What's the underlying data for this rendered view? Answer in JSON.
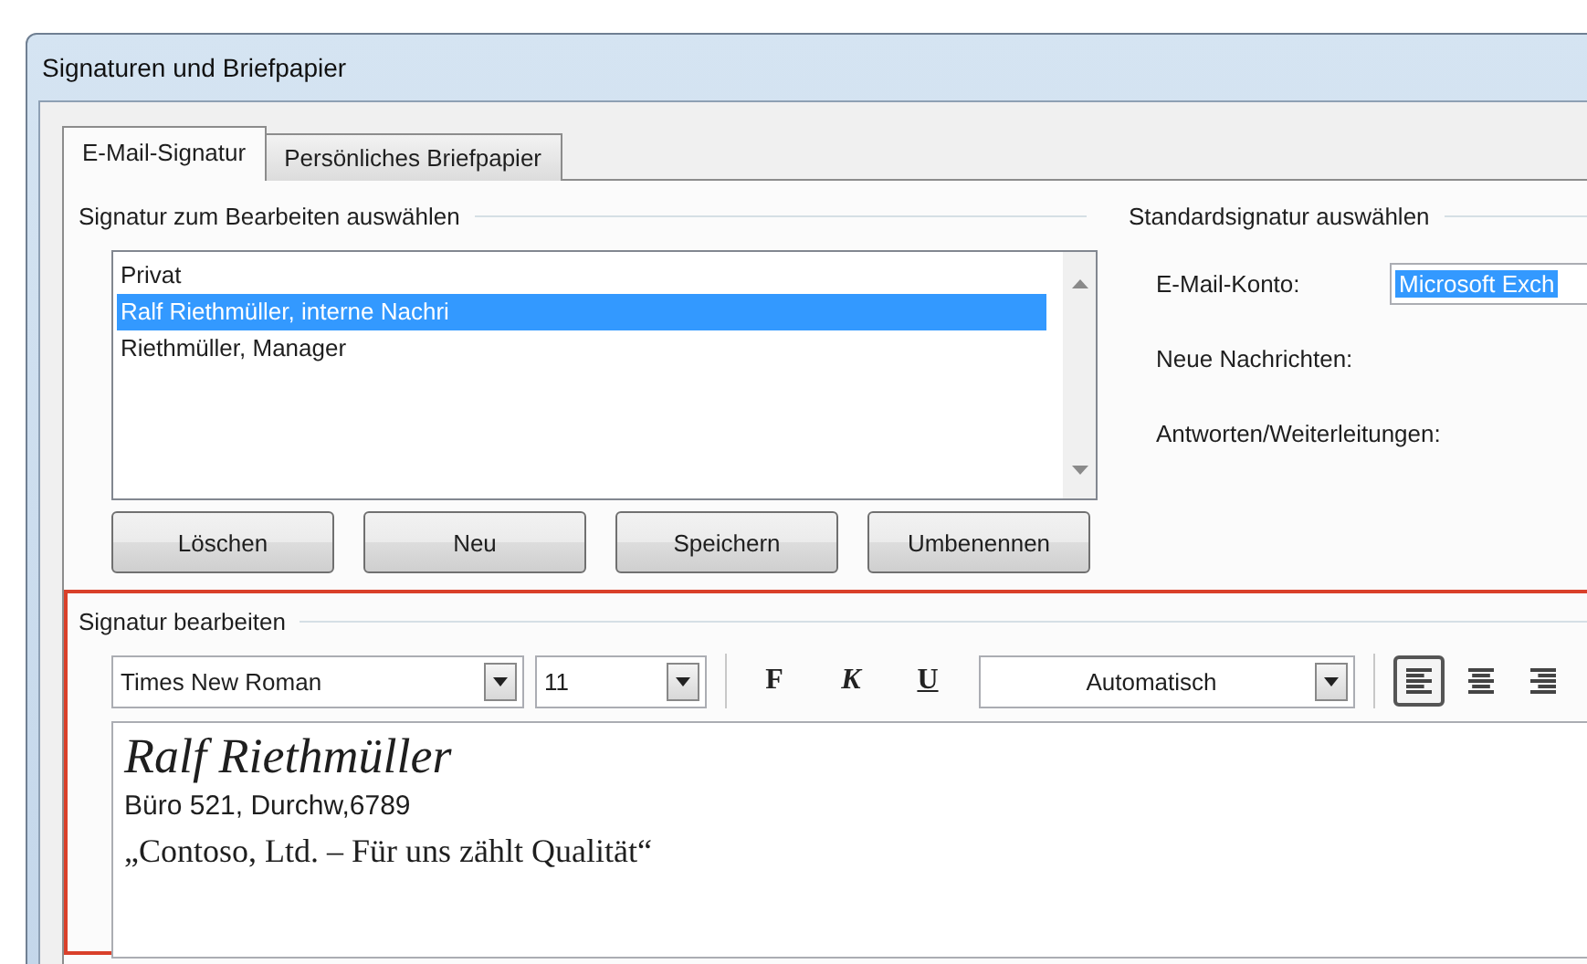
{
  "window": {
    "title": "Signaturen und Briefpapier"
  },
  "tabs": [
    {
      "label": "E-Mail-Signatur",
      "selected": true
    },
    {
      "label": "Persönliches Briefpapier",
      "selected": false
    }
  ],
  "signature_select": {
    "title": "Signatur zum Bearbeiten auswählen",
    "items": [
      {
        "label": "Privat",
        "selected": false
      },
      {
        "label": "Ralf Riethmüller, interne Nachri",
        "selected": true
      },
      {
        "label": "Riethmüller, Manager",
        "selected": false
      }
    ],
    "buttons": [
      "Löschen",
      "Neu",
      "Speichern",
      "Umbenennen"
    ]
  },
  "default_signature": {
    "title": "Standardsignatur auswählen",
    "fields": [
      {
        "label": "E-Mail-Konto:",
        "value": "Microsoft Exch"
      },
      {
        "label": "Neue Nachrichten:"
      },
      {
        "label": "Antworten/Weiterleitungen:"
      }
    ]
  },
  "editor": {
    "title": "Signatur bearbeiten",
    "highlighted": true,
    "font": "Times New Roman",
    "size": "11",
    "format_buttons": [
      {
        "kind": "bold",
        "label": "F"
      },
      {
        "kind": "italic",
        "label": "K"
      },
      {
        "kind": "underline",
        "label": "U"
      }
    ],
    "color_label": "Automatisch",
    "alignment_buttons": [
      {
        "kind": "left",
        "selected": true
      },
      {
        "kind": "center",
        "selected": false
      },
      {
        "kind": "right",
        "selected": false
      }
    ],
    "lines": [
      {
        "kind": "name",
        "text": "Ralf Riethmüller"
      },
      {
        "kind": "plain",
        "text": "Büro 521, Durchw,6789"
      },
      {
        "kind": "serif",
        "text": "„Contoso, Ltd. – Für uns zählt Qualität“"
      }
    ]
  }
}
